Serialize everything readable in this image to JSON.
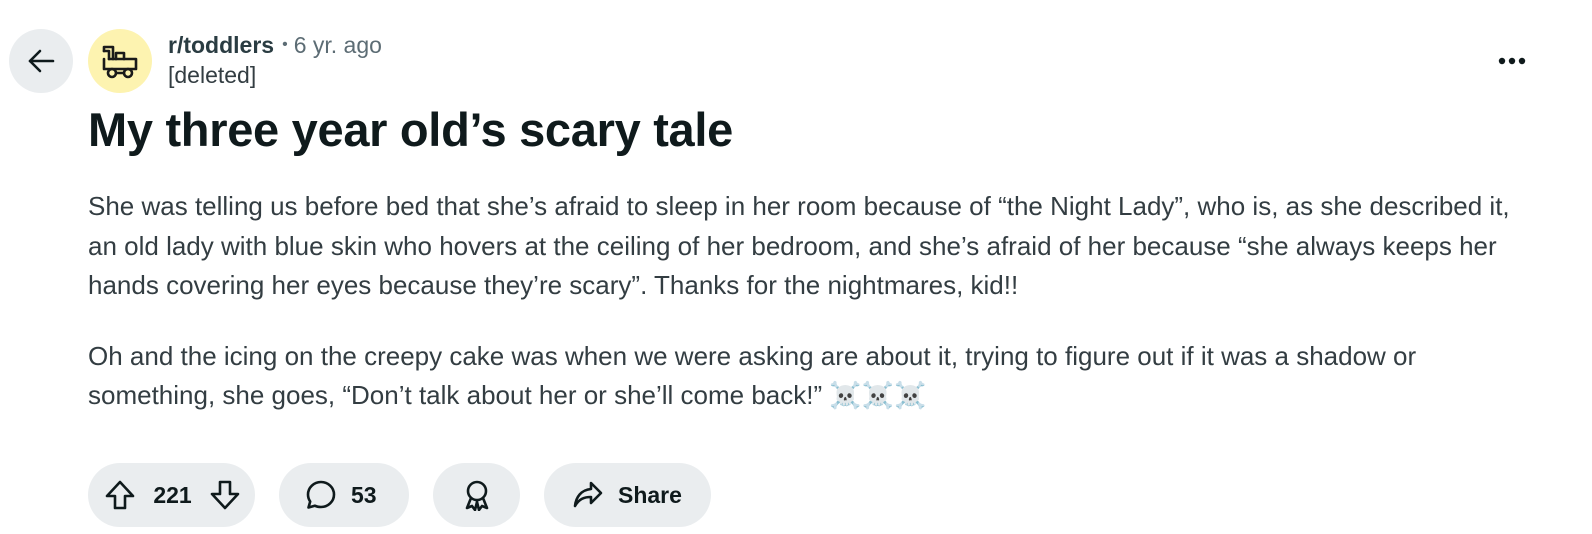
{
  "post": {
    "subreddit": "r/toddlers",
    "separator": "•",
    "age": "6 yr. ago",
    "author": "[deleted]",
    "title": "My three year old’s scary tale",
    "paragraphs": [
      "She was telling us before bed that she’s afraid to sleep in her room because of “the Night Lady”, who is, as she described it, an old lady with blue skin who hovers at the ceiling of her bedroom, and she’s afraid of her because “she always keeps her hands covering her eyes because they’re scary”. Thanks for the nightmares, kid!!",
      "Oh and the icing on the creepy cake was when we were asking are about it, trying to figure out if it was a shadow or something, she goes, “Don’t talk about her or she’ll come back!” ☠️☠️☠️"
    ]
  },
  "actions": {
    "vote_count": "221",
    "comment_count": "53",
    "share_label": "Share"
  },
  "icons": {
    "back": "arrow-left-icon",
    "avatar": "train-icon",
    "more": "overflow-menu-icon",
    "upvote": "arrow-up-icon",
    "downvote": "arrow-down-icon",
    "comment": "speech-bubble-icon",
    "award": "award-icon",
    "share": "share-arrow-icon"
  },
  "colors": {
    "avatar_bg": "#fdf3b0",
    "pill_bg": "#eaedef",
    "text_primary": "#0f1a1c",
    "text_body": "#333d42",
    "text_muted": "#5c6c74"
  }
}
